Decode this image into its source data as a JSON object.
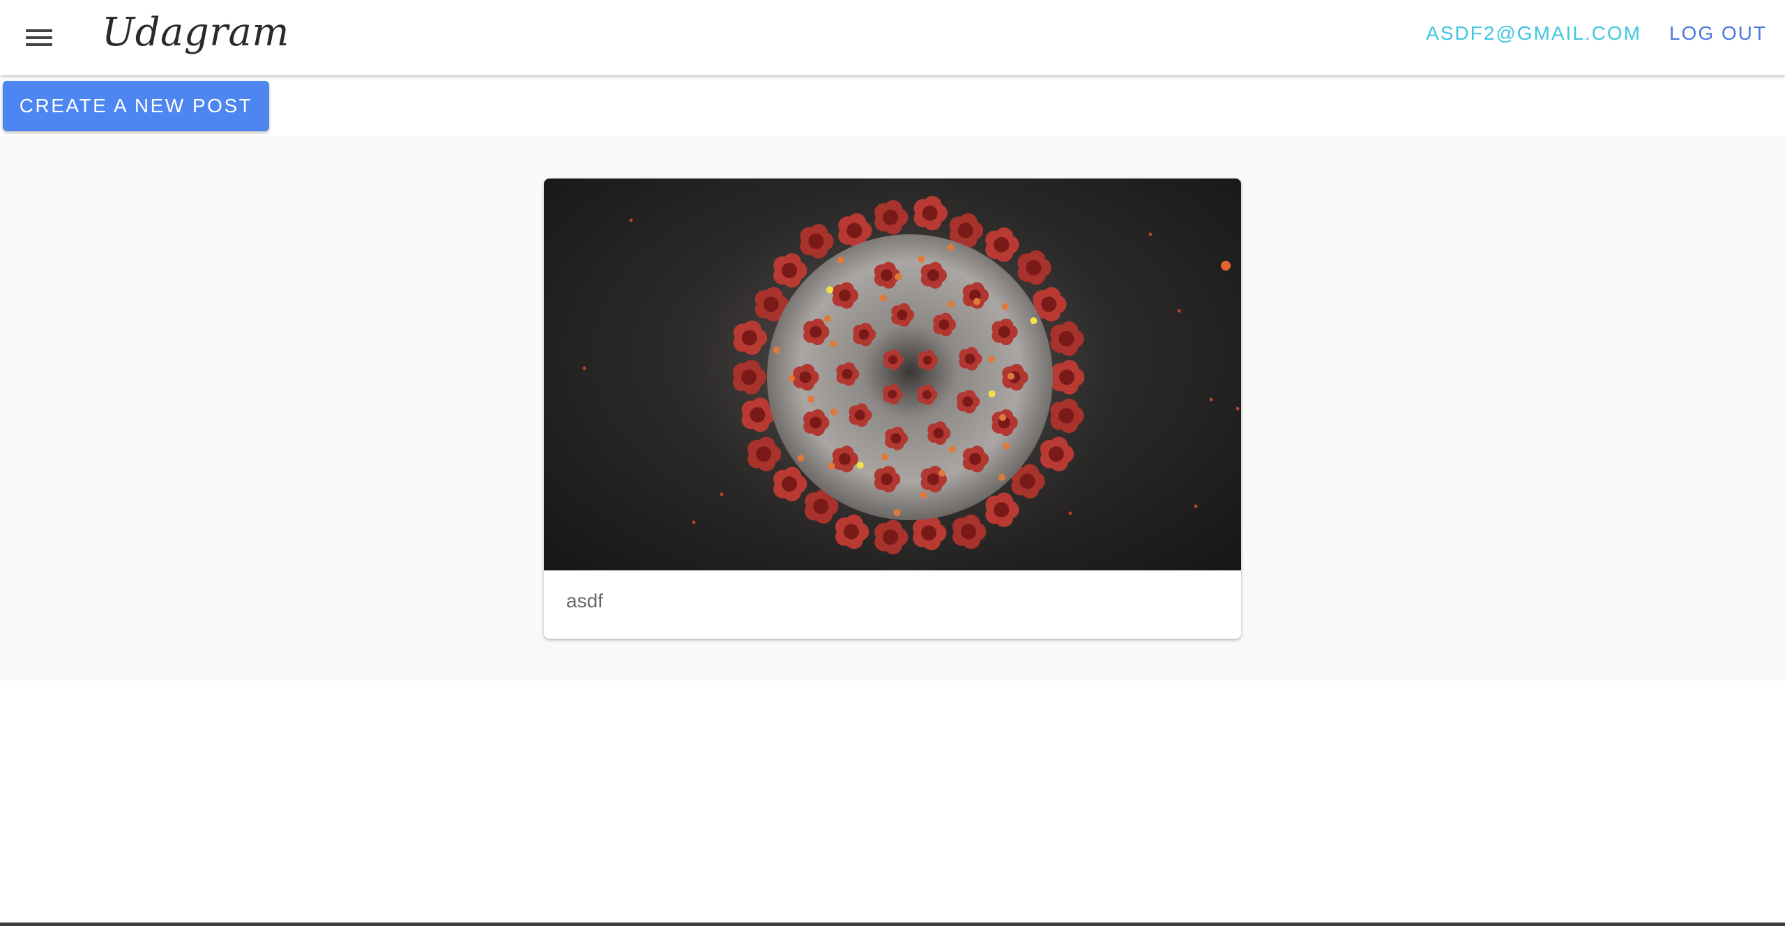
{
  "app": {
    "brand": "Udagram"
  },
  "nav": {
    "user_email": "ASDF2@GMAIL.COM",
    "logout_label": "LOG OUT"
  },
  "actions": {
    "create_post_label": "CREATE A NEW POST"
  },
  "feed": {
    "posts": [
      {
        "caption": "asdf",
        "image_subject": "virus-illustration"
      }
    ]
  },
  "colors": {
    "primary_button": "#4d86f0",
    "email_link": "#3ec7e0",
    "logout_link": "#4a78e0",
    "feed_background": "#f9f9f9"
  },
  "icons": {
    "menu": "hamburger-menu-icon"
  }
}
